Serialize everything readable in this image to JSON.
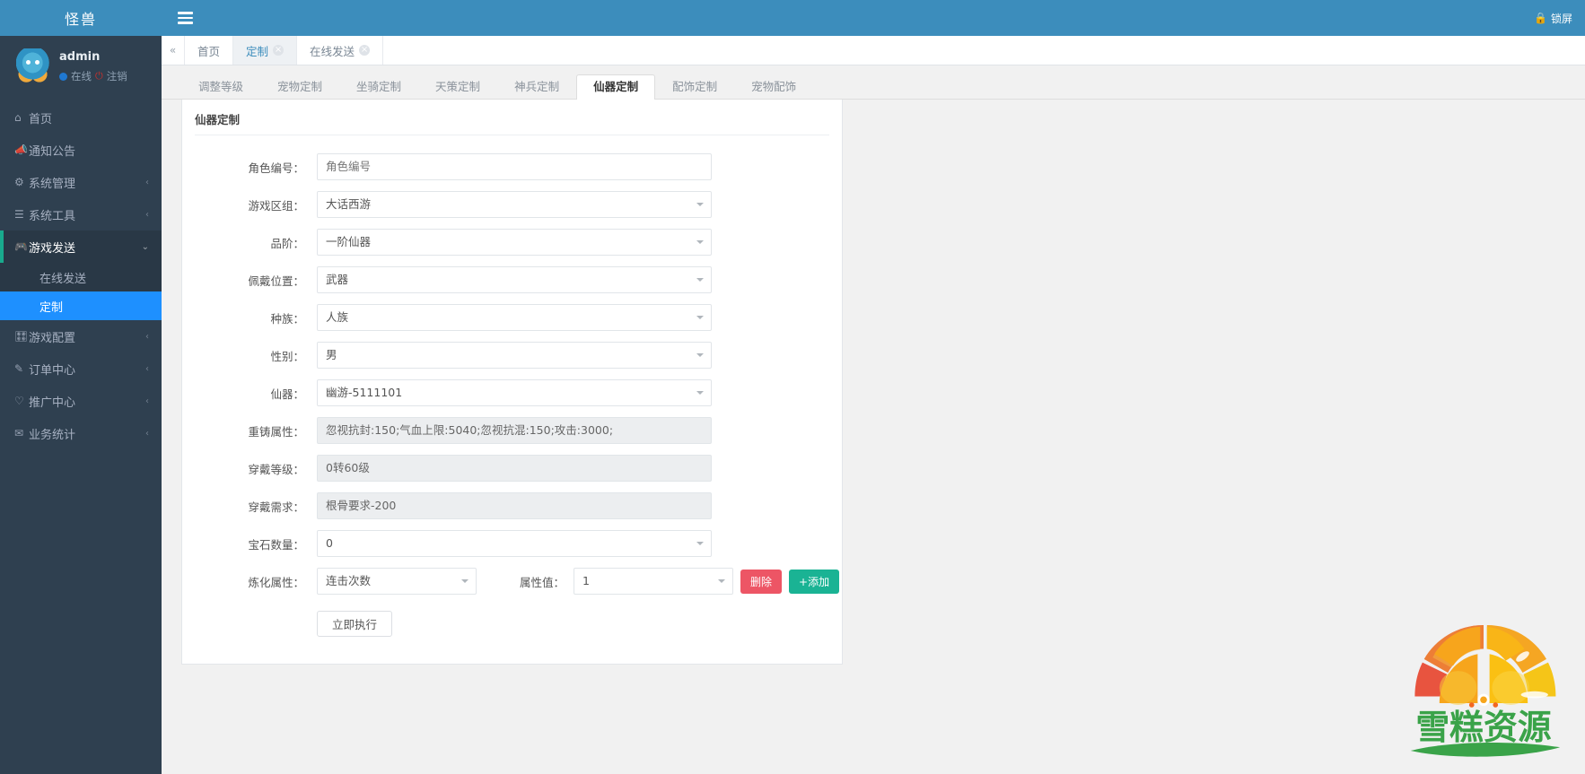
{
  "brand": {
    "title": "怪兽"
  },
  "profile": {
    "name": "admin",
    "status": "在线",
    "logout": "注销"
  },
  "sidebar": {
    "items": [
      {
        "label": "首页",
        "icon": "home-icon",
        "caret": ""
      },
      {
        "label": "通知公告",
        "icon": "megaphone-icon",
        "caret": ""
      },
      {
        "label": "系统管理",
        "icon": "gear-icon",
        "caret": "‹"
      },
      {
        "label": "系统工具",
        "icon": "list-icon",
        "caret": "‹"
      },
      {
        "label": "游戏发送",
        "icon": "gamepad-icon",
        "caret": "⌄"
      },
      {
        "label": "游戏配置",
        "icon": "sliders-icon",
        "caret": "‹"
      },
      {
        "label": "订单中心",
        "icon": "pen-icon",
        "caret": "‹"
      },
      {
        "label": "推广中心",
        "icon": "heart-icon",
        "caret": "‹"
      },
      {
        "label": "业务统计",
        "icon": "envelope-icon",
        "caret": "‹"
      }
    ],
    "submenu": [
      {
        "label": "在线发送",
        "active": false
      },
      {
        "label": "定制",
        "active": true
      }
    ]
  },
  "topbar": {
    "menu_toggle": "hamburger-icon",
    "lock_label": "锁屏",
    "lock_icon": "lock-icon"
  },
  "tabbar": {
    "scroll_left": "«",
    "tabs": [
      {
        "label": "首页",
        "closable": false,
        "active": false
      },
      {
        "label": "定制",
        "closable": true,
        "active": true
      },
      {
        "label": "在线发送",
        "closable": true,
        "active": false
      }
    ],
    "close_glyph": "×"
  },
  "content_tabs": [
    {
      "label": "调整等级",
      "active": false
    },
    {
      "label": "宠物定制",
      "active": false
    },
    {
      "label": "坐骑定制",
      "active": false
    },
    {
      "label": "天策定制",
      "active": false
    },
    {
      "label": "神兵定制",
      "active": false
    },
    {
      "label": "仙器定制",
      "active": true
    },
    {
      "label": "配饰定制",
      "active": false
    },
    {
      "label": "宠物配饰",
      "active": false
    }
  ],
  "panel": {
    "title": "仙器定制",
    "fields": [
      {
        "label": "角色编号：",
        "value": "",
        "placeholder": "角色编号",
        "type": "text",
        "readonly": false,
        "name": "role-id"
      },
      {
        "label": "游戏区组：",
        "value": "大话西游",
        "placeholder": "",
        "type": "select",
        "readonly": false,
        "name": "game-zone"
      },
      {
        "label": "品阶：",
        "value": "一阶仙器",
        "placeholder": "",
        "type": "select",
        "readonly": false,
        "name": "grade"
      },
      {
        "label": "佩戴位置：",
        "value": "武器",
        "placeholder": "",
        "type": "select",
        "readonly": false,
        "name": "equip-slot"
      },
      {
        "label": "种族：",
        "value": "人族",
        "placeholder": "",
        "type": "select",
        "readonly": false,
        "name": "race"
      },
      {
        "label": "性别：",
        "value": "男",
        "placeholder": "",
        "type": "select",
        "readonly": false,
        "name": "gender"
      },
      {
        "label": "仙器：",
        "value": "幽游-5111101",
        "placeholder": "",
        "type": "select",
        "readonly": false,
        "name": "artifact"
      },
      {
        "label": "重铸属性：",
        "value": "忽视抗封:150;气血上限:5040;忽视抗混:150;攻击:3000;",
        "placeholder": "",
        "type": "text",
        "readonly": true,
        "name": "recast-attrs"
      },
      {
        "label": "穿戴等级：",
        "value": "0转60级",
        "placeholder": "",
        "type": "text",
        "readonly": true,
        "name": "equip-level"
      },
      {
        "label": "穿戴需求：",
        "value": "根骨要求-200",
        "placeholder": "",
        "type": "text",
        "readonly": true,
        "name": "equip-requirement"
      },
      {
        "label": "宝石数量：",
        "value": "0",
        "placeholder": "",
        "type": "select",
        "readonly": false,
        "name": "gem-count"
      }
    ],
    "refine_row": {
      "label": "炼化属性：",
      "attr_value": "连击次数",
      "value_label": "属性值：",
      "value_value": "1",
      "delete_label": "删除",
      "add_label": "+添加"
    },
    "submit_label": "立即执行"
  },
  "watermark": {
    "text": "雪糕资源"
  },
  "colors": {
    "brand_blue": "#3c8dbc",
    "sidebar_bg": "#2f4050",
    "active_blue": "#1e90ff",
    "danger": "#ed5565",
    "success": "#1ab394",
    "watermark_green": "#3aa349",
    "watermark_orange": "#f5a623"
  }
}
